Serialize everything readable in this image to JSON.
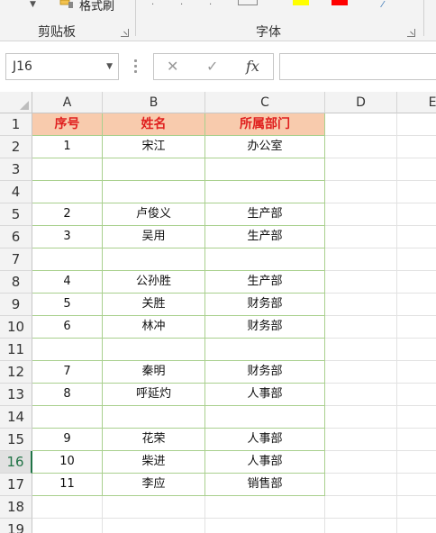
{
  "ribbon": {
    "format_painter_label": "格式刷",
    "clipboard_group_label": "剪贴板",
    "font_group_label": "字体",
    "font_fill_color": "#ffff00",
    "font_text_color": "#ff0000"
  },
  "formula_bar": {
    "name_box_value": "J16",
    "cancel_symbol": "✕",
    "enter_symbol": "✓",
    "fx_label": "fx",
    "formula_value": ""
  },
  "grid": {
    "columns": [
      "A",
      "B",
      "C",
      "D",
      "E"
    ],
    "rows": [
      "1",
      "2",
      "3",
      "4",
      "5",
      "6",
      "7",
      "8",
      "9",
      "10",
      "11",
      "12",
      "13",
      "14",
      "15",
      "16",
      "17",
      "18",
      "19"
    ],
    "active_row": "16",
    "header_fill": "#f8cbad",
    "header_text_color": "#e0201f",
    "border_color": "#a9d08e",
    "table": {
      "headers": [
        "序号",
        "姓名",
        "所属部门"
      ],
      "rows": [
        [
          "1",
          "宋江",
          "办公室"
        ],
        [
          "",
          "",
          ""
        ],
        [
          "",
          "",
          ""
        ],
        [
          "2",
          "卢俊义",
          "生产部"
        ],
        [
          "3",
          "吴用",
          "生产部"
        ],
        [
          "",
          "",
          ""
        ],
        [
          "4",
          "公孙胜",
          "生产部"
        ],
        [
          "5",
          "关胜",
          "财务部"
        ],
        [
          "6",
          "林冲",
          "财务部"
        ],
        [
          "",
          "",
          ""
        ],
        [
          "7",
          "秦明",
          "财务部"
        ],
        [
          "8",
          "呼延灼",
          "人事部"
        ],
        [
          "",
          "",
          ""
        ],
        [
          "9",
          "花荣",
          "人事部"
        ],
        [
          "10",
          "柴进",
          "人事部"
        ],
        [
          "11",
          "李应",
          "销售部"
        ]
      ]
    }
  }
}
